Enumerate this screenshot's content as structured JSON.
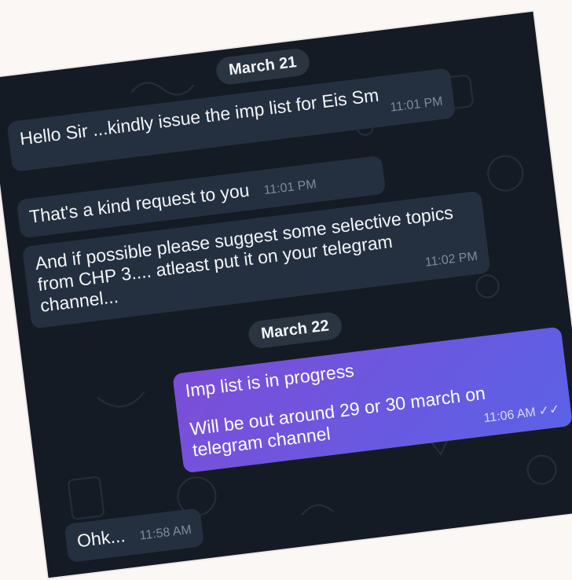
{
  "messages": [
    {
      "date": "March 21",
      "items": [
        {
          "text": "Hello Sir ...kindly issue the imp list for Eis Sm",
          "time": "11:01 PM",
          "outgoing": false
        },
        {
          "text": "That's a kind request to you",
          "time": "11:01 PM",
          "outgoing": false
        },
        {
          "text": "And if possible please suggest some selective topics from CHP 3.... atleast put it on your telegram channel...",
          "time": "11:02 PM",
          "outgoing": false
        }
      ]
    },
    {
      "date": "March 22",
      "items": [
        {
          "text_line1": "Imp list is in progress",
          "text_line2": "Will be out around 29 or 30 march on telegram channel",
          "time": "11:06 AM",
          "outgoing": true,
          "status": "double-check-icon"
        },
        {
          "text": "Ohk...",
          "time": "11:58 AM",
          "outgoing": false
        }
      ]
    }
  ],
  "colors": {
    "background": "#141b24",
    "incoming_bubble": "#243040",
    "outgoing_bubble_start": "#7c4dd8",
    "outgoing_bubble_end": "#5b62e6",
    "date_pill": "#2b3441"
  }
}
